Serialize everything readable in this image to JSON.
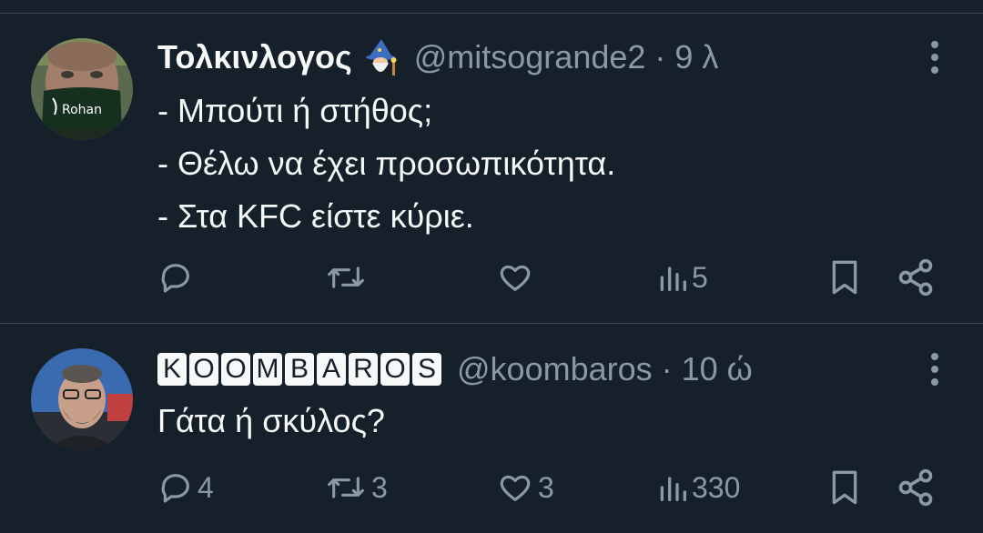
{
  "tweets": [
    {
      "name": "Τολκινλογος",
      "name_emoji": "wizard-emoji",
      "handle": "@mitsogrande2",
      "separator": "·",
      "time": "9 λ",
      "lines": [
        "- Μπούτι ή στήθος;",
        "- Θέλω να έχει προσωπικότητα.",
        "- Στα KFC είστε κύριε."
      ],
      "avatar_text": "Rohan",
      "counts": {
        "replies": "",
        "retweets": "",
        "likes": "",
        "views": "5"
      }
    },
    {
      "name_letters": [
        "K",
        "O",
        "O",
        "M",
        "B",
        "A",
        "R",
        "O",
        "S"
      ],
      "handle": "@koombaros",
      "separator": "·",
      "time": "10 ώ",
      "lines": [
        "Γάτα ή σκύλος?"
      ],
      "counts": {
        "replies": "4",
        "retweets": "3",
        "likes": "3",
        "views": "330"
      }
    }
  ],
  "colors": {
    "background": "#15202b",
    "text": "#f7f9f9",
    "muted": "#8b98a5",
    "divider": "#38444d"
  },
  "icons": [
    "reply-icon",
    "retweet-icon",
    "like-icon",
    "views-icon",
    "bookmark-icon",
    "share-icon",
    "more-icon"
  ]
}
